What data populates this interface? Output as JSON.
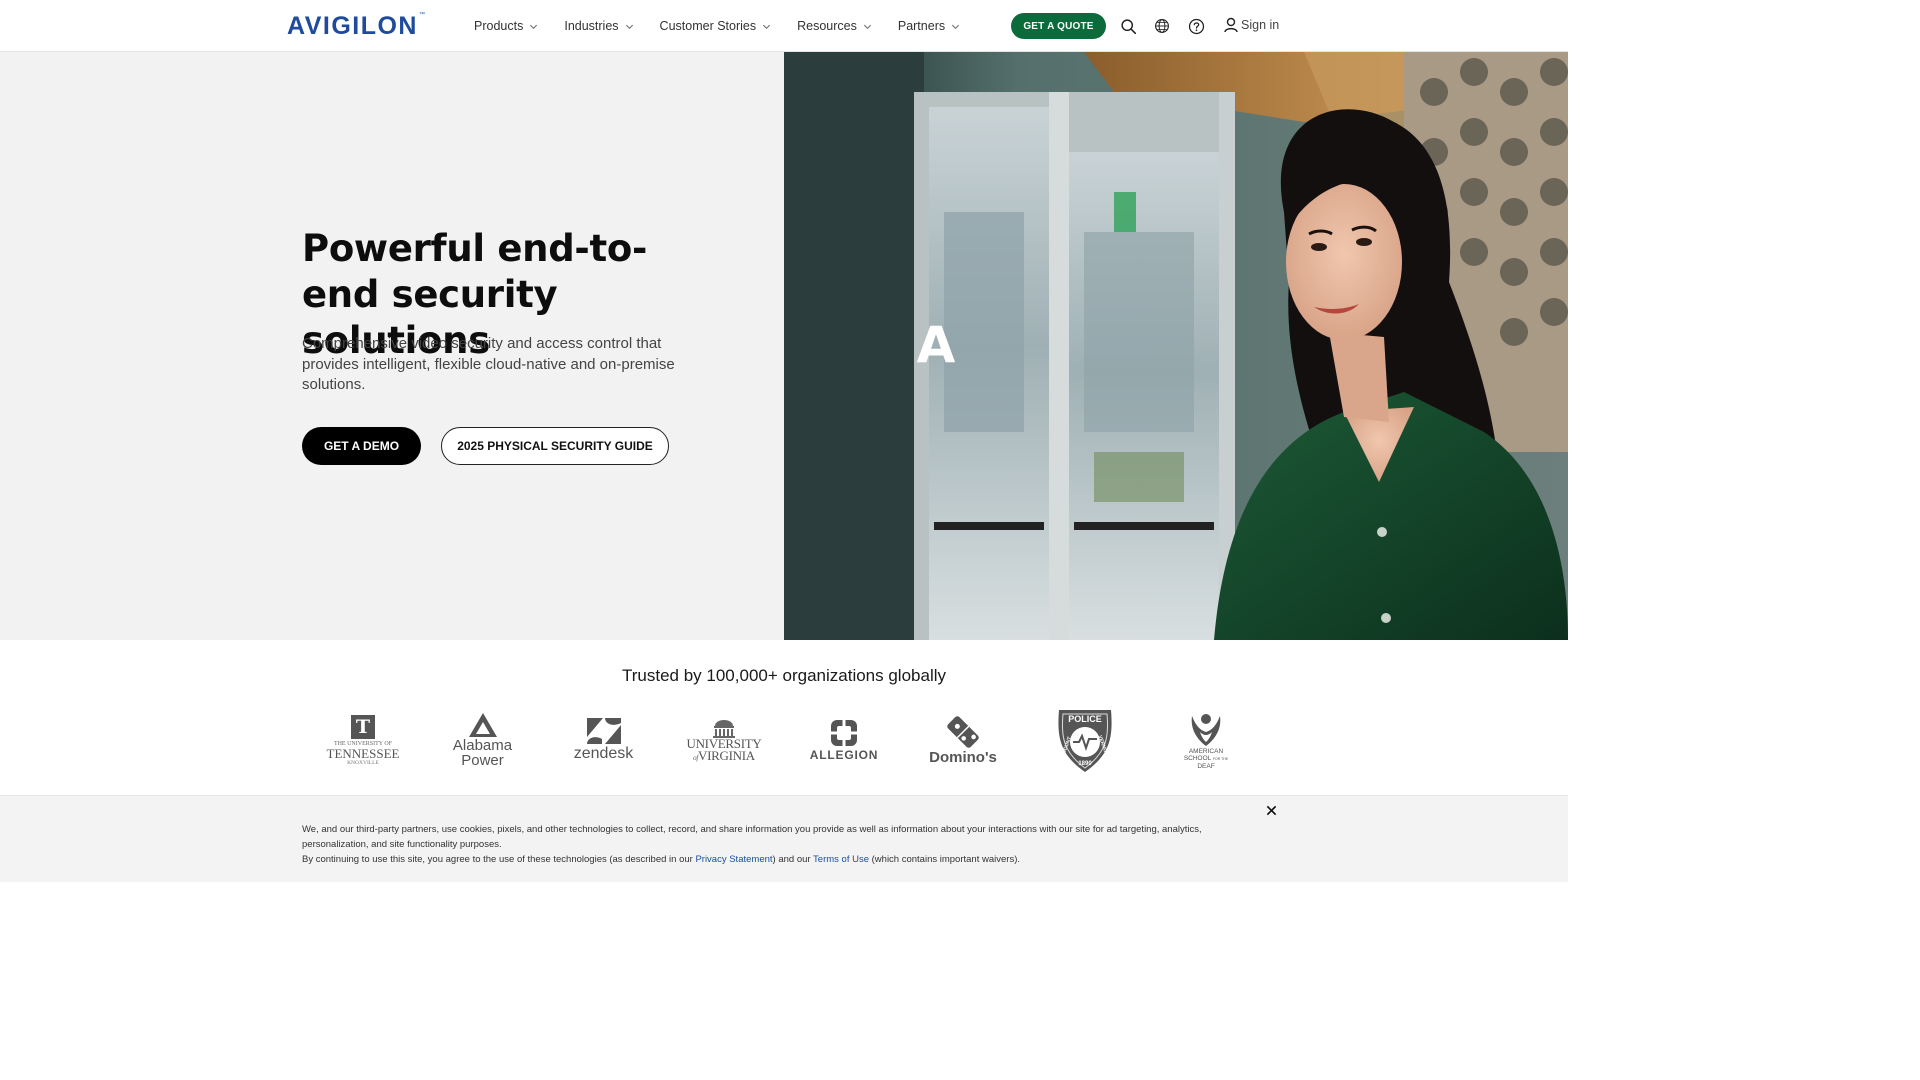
{
  "header": {
    "logo": "AVIGILON",
    "logo_tm": "™",
    "nav": [
      {
        "label": "Products"
      },
      {
        "label": "Industries"
      },
      {
        "label": "Customer Stories"
      },
      {
        "label": "Resources"
      },
      {
        "label": "Partners"
      }
    ],
    "quote_button": "GET A QUOTE",
    "search_icon": "search-icon",
    "globe_icon": "globe-icon",
    "help_icon": "help-icon",
    "signin_label": "Sign in",
    "accent_color": "#0b6b3a",
    "brand_color": "#1f4b9c"
  },
  "hero": {
    "title": "Powerful end-to-end security solutions",
    "subtitle": "Comprehensive video security and access control that provides intelligent, flexible cloud-native and on-premise solutions.",
    "demo_button": "GET A DEMO",
    "guide_button": "2025 PHYSICAL SECURITY GUIDE",
    "video_overlay_letter": "A"
  },
  "trusted": {
    "title": "Trusted by 100,000+ organizations globally",
    "logos": [
      {
        "name": "the-university-of-tennessee-knoxville",
        "line1": "THE UNIVERSITY OF",
        "line2": "TENNESSEE",
        "line3": "KNOXVILLE",
        "mark": "T"
      },
      {
        "name": "alabama-power",
        "line1": "Alabama",
        "line2": "Power"
      },
      {
        "name": "zendesk",
        "line1": "zendesk"
      },
      {
        "name": "university-of-virginia",
        "line1": "UNIVERSITY",
        "line2": "VIRGINIA",
        "line_of": "of"
      },
      {
        "name": "allegion",
        "line1": "ALLEGION"
      },
      {
        "name": "dominos",
        "line1": "Domino's"
      },
      {
        "name": "mount-vernon-police",
        "line1": "POLICE",
        "line2": "MOUNT",
        "line3": "VERNON",
        "line4": "1890"
      },
      {
        "name": "american-school-for-the-deaf",
        "line1": "AMERICAN",
        "line2": "SCHOOL",
        "line_ftt": "FOR THE",
        "line3": "DEAF"
      }
    ]
  },
  "cookie": {
    "line1": "We, and our third-party partners, use cookies, pixels, and other technologies to collect, record, and share information you provide as well as information about your interactions with our site for ad targeting, analytics, personalization, and site functionality purposes.",
    "line2_pre": "By continuing to use this site, you agree to the use of these technologies (as described in our ",
    "privacy_link": "Privacy Statement",
    "line2_mid": ") and our ",
    "terms_link": "Terms of Use",
    "line2_post": " (which contains important waivers).",
    "close_icon": "close-icon"
  }
}
